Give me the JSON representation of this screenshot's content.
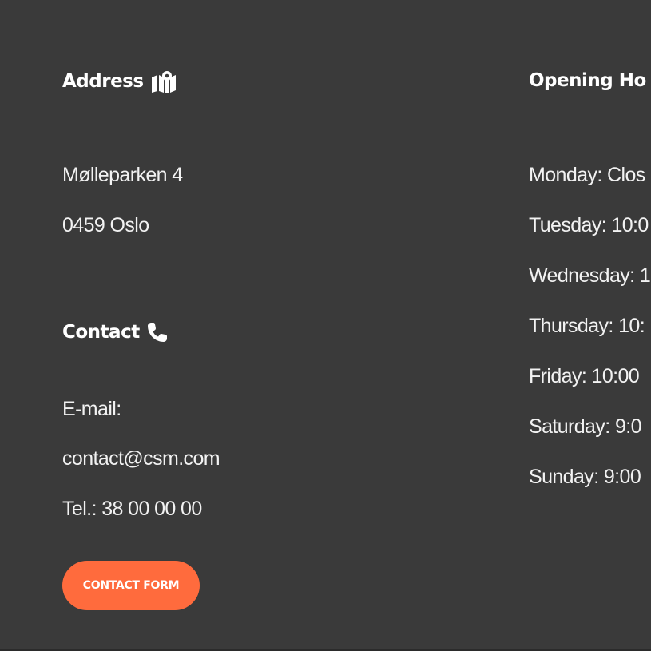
{
  "address": {
    "heading": "Address",
    "icon": "map-icon",
    "street": "Mølleparken 4",
    "city": "0459 Oslo"
  },
  "contact": {
    "heading": "Contact",
    "icon": "phone-icon",
    "email_label": "E-mail:",
    "email": "contact@csm.com",
    "phone": "Tel.: 38 00 00 00",
    "button_label": "CONTACT FORM"
  },
  "hours": {
    "heading": "Opening Ho",
    "days": [
      "Monday: Clos",
      "Tuesday: 10:0",
      "Wednesday: 1",
      "Thursday: 10:",
      "Friday: 10:00",
      "Saturday: 9:0",
      "Sunday: 9:00"
    ]
  },
  "colors": {
    "background": "#3a3a3a",
    "accent": "#ff6b3d",
    "text": "#ffffff"
  }
}
